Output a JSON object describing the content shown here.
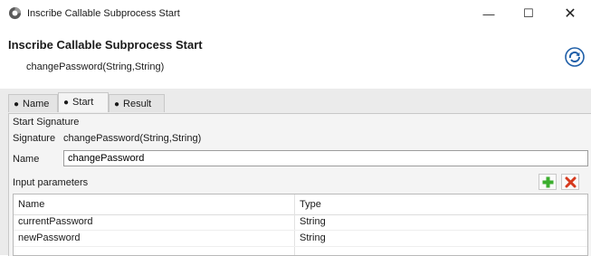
{
  "window": {
    "title": "Inscribe Callable Subprocess Start",
    "minimize": "—",
    "maximize": "☐",
    "close": "✕"
  },
  "header": {
    "title": "Inscribe Callable Subprocess Start",
    "subtitle": "changePassword(String,String)"
  },
  "tabs": [
    {
      "label": "Name",
      "active": false
    },
    {
      "label": "Start",
      "active": true
    },
    {
      "label": "Result",
      "active": false
    }
  ],
  "start": {
    "section_label": "Start Signature",
    "signature_label": "Signature",
    "signature_value": "changePassword(String,String)",
    "name_label": "Name",
    "name_value": "changePassword",
    "params_label": "Input parameters",
    "columns": [
      "Name",
      "Type"
    ],
    "rows": [
      {
        "name": "currentPassword",
        "type": "String"
      },
      {
        "name": "newPassword",
        "type": "String"
      }
    ]
  },
  "icons": {
    "app": "process-icon",
    "refresh": "refresh-icon",
    "add": "add-plus-icon",
    "delete": "delete-x-icon"
  },
  "colors": {
    "add": "#3cae2e",
    "delete": "#d63a1e",
    "refresh": "#1f5fa8"
  }
}
